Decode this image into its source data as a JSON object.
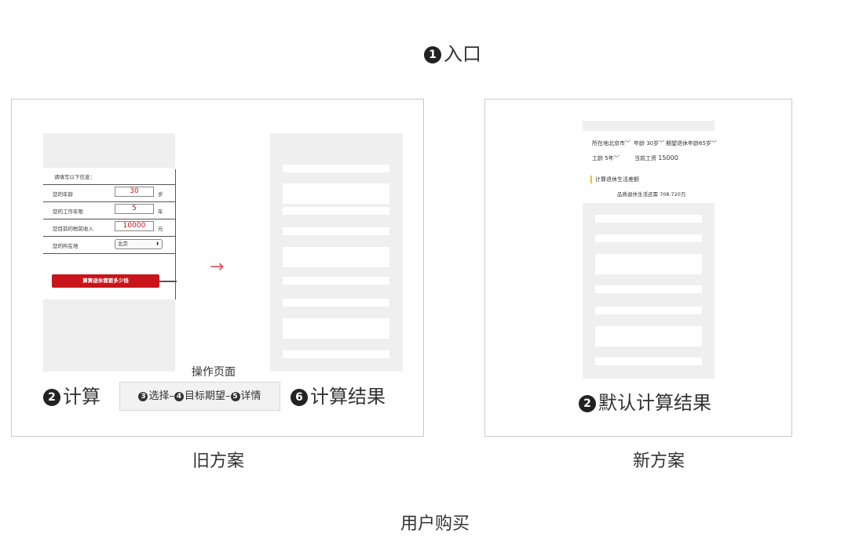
{
  "entry": {
    "num": "1",
    "label": "入口"
  },
  "old_scheme": {
    "title": "旧方案",
    "step_calc": {
      "num": "2",
      "label": "计算"
    },
    "step_result": {
      "num": "6",
      "label": "计算结果"
    },
    "operation_page": "操作页面",
    "steps_box": {
      "s3_num": "3",
      "s3": "选择",
      "s4_num": "4",
      "s4": "目标期望",
      "s5_num": "5",
      "s5": "详情",
      "sep": "–"
    },
    "form": {
      "heading": "请填写以下信息：",
      "rows": [
        {
          "label": "您的年龄",
          "value": "30",
          "unit": "岁"
        },
        {
          "label": "您的工作年限",
          "value": "5",
          "unit": "年"
        },
        {
          "label": "您目前的税前收入",
          "value": "10000",
          "unit": "元"
        }
      ],
      "location_label": "您的所在地",
      "location_value": "北京",
      "select_arrow": "⬍",
      "button": "算算退休需要多少钱"
    },
    "arrow": "→"
  },
  "new_scheme": {
    "title": "新方案",
    "step": {
      "num": "2",
      "label": "默认计算结果"
    },
    "filters": {
      "location": "所在地北京市",
      "age": "年龄 30岁",
      "expect": "期望退休年龄65岁",
      "seniority": "工龄 5年",
      "salary_label": "当前工资",
      "salary_value": "15000",
      "chevron": "﹀"
    },
    "section_title": "计算退休生活差额",
    "result_text": "品质退休生活还需 708.720万"
  },
  "purchase": {
    "label": "用户购买"
  },
  "colors": {
    "accent_red": "#c8141a",
    "arrow_red": "#e05a62",
    "accent_yellow": "#f5c518"
  }
}
